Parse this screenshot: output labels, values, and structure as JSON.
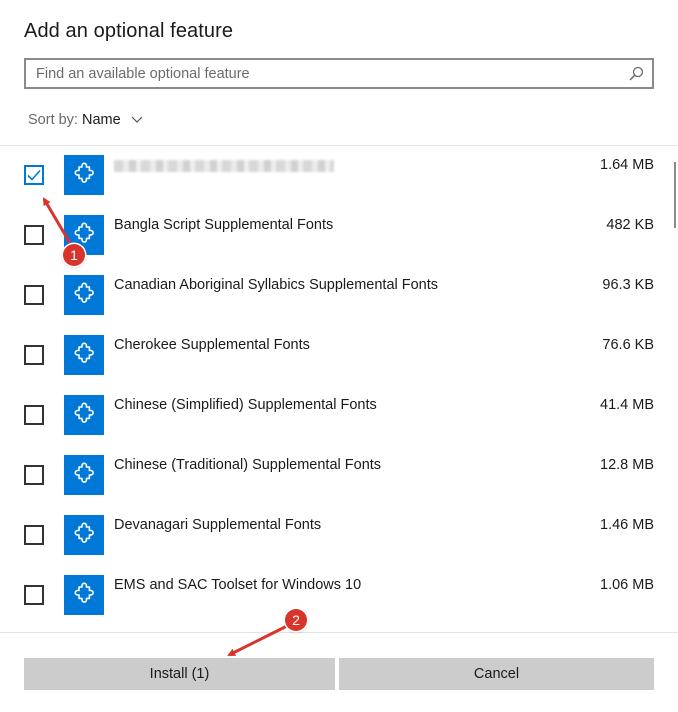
{
  "dialog": {
    "title": "Add an optional feature"
  },
  "search": {
    "placeholder": "Find an available optional feature",
    "icon": "search-icon"
  },
  "sort": {
    "label": "Sort by:",
    "value": "Name"
  },
  "features": [
    {
      "name": "",
      "size": "1.64 MB",
      "checked": true,
      "name_obscured": true
    },
    {
      "name": "Bangla Script Supplemental Fonts",
      "size": "482 KB",
      "checked": false
    },
    {
      "name": "Canadian Aboriginal Syllabics Supplemental Fonts",
      "size": "96.3 KB",
      "checked": false
    },
    {
      "name": "Cherokee Supplemental Fonts",
      "size": "76.6 KB",
      "checked": false
    },
    {
      "name": "Chinese (Simplified) Supplemental Fonts",
      "size": "41.4 MB",
      "checked": false
    },
    {
      "name": "Chinese (Traditional) Supplemental Fonts",
      "size": "12.8 MB",
      "checked": false
    },
    {
      "name": "Devanagari Supplemental Fonts",
      "size": "1.46 MB",
      "checked": false
    },
    {
      "name": "EMS and SAC Toolset for Windows 10",
      "size": "1.06 MB",
      "checked": false
    }
  ],
  "buttons": {
    "install_label": "Install (1)",
    "cancel_label": "Cancel"
  },
  "annotations": [
    {
      "label": "1"
    },
    {
      "label": "2"
    }
  ],
  "colors": {
    "accent": "#0078d7",
    "annotation": "#d9342b",
    "button_bg": "#cccccc"
  }
}
